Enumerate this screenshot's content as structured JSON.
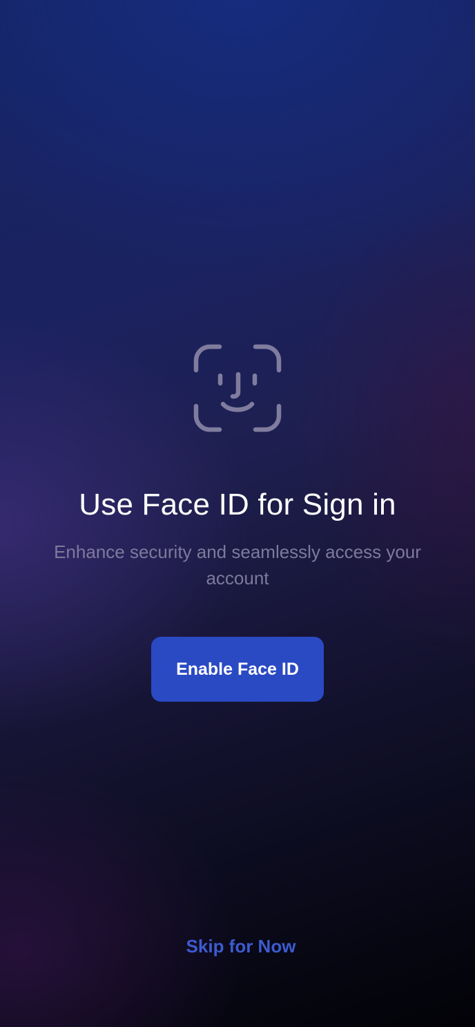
{
  "icon": "face-id-icon",
  "colors": {
    "accent": "#2a4ac4",
    "link": "#3d5bd0",
    "title": "#ffffff",
    "subtitle": "#7d7a9c",
    "icon_stroke": "#7f7c9e"
  },
  "title": "Use Face ID for Sign in",
  "subtitle": "Enhance security and seamlessly access your account",
  "primary_button_label": "Enable Face ID",
  "skip_link_label": "Skip for Now"
}
